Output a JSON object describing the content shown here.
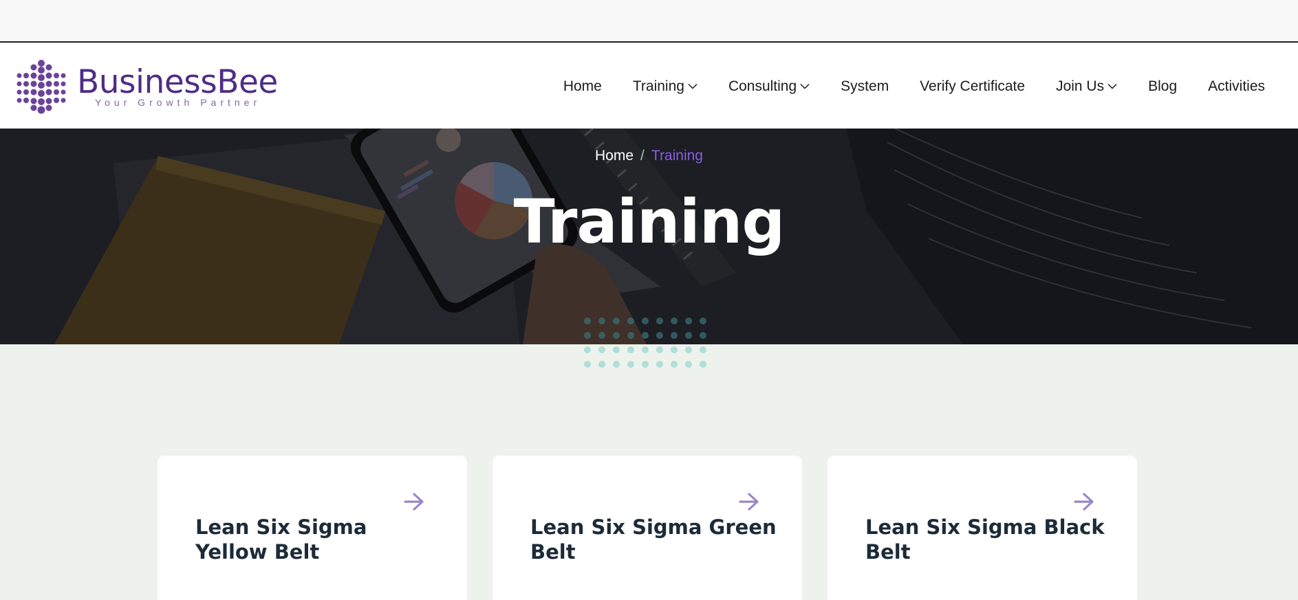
{
  "brand": {
    "name": "BusinessBee",
    "tagline": "Your Growth Partner",
    "primary_color": "#4f2d86",
    "accent_color": "#8a5ce0"
  },
  "nav": {
    "items": [
      {
        "label": "Home",
        "has_dropdown": false
      },
      {
        "label": "Training",
        "has_dropdown": true
      },
      {
        "label": "Consulting",
        "has_dropdown": true
      },
      {
        "label": "System",
        "has_dropdown": false
      },
      {
        "label": "Verify Certificate",
        "has_dropdown": false
      },
      {
        "label": "Join Us",
        "has_dropdown": true
      },
      {
        "label": "Blog",
        "has_dropdown": false
      },
      {
        "label": "Activities",
        "has_dropdown": false
      }
    ]
  },
  "hero": {
    "breadcrumb": {
      "home": "Home",
      "separator": "/",
      "current": "Training"
    },
    "title": "Training"
  },
  "cards": [
    {
      "title": "Lean Six Sigma Yellow Belt",
      "icon": "arrow-right-icon"
    },
    {
      "title": "Lean Six Sigma Green Belt",
      "icon": "arrow-right-icon"
    },
    {
      "title": "Lean Six Sigma Black Belt",
      "icon": "arrow-right-icon"
    }
  ]
}
